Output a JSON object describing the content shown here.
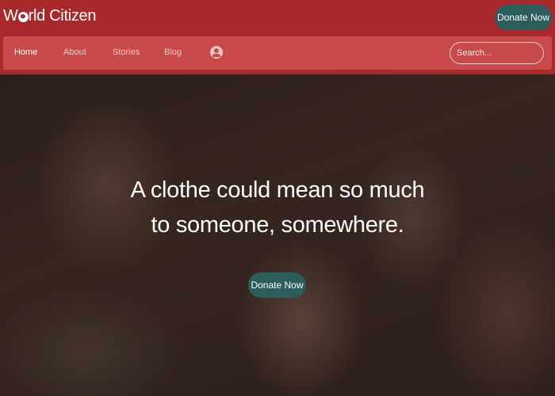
{
  "brand": {
    "name_prefix": "W",
    "name_suffix": "rld Citizen",
    "icon": "globe-icon"
  },
  "header": {
    "donate_label": "Donate Now"
  },
  "nav": {
    "items": [
      {
        "label": "Home",
        "active": true
      },
      {
        "label": "About",
        "active": false
      },
      {
        "label": "Stories",
        "active": false
      },
      {
        "label": "Blog",
        "active": false
      }
    ],
    "user_icon": "user-circle-icon",
    "search_placeholder": "Search..."
  },
  "hero": {
    "line1": "A clothe could mean so much",
    "line2": "to someone, somewhere.",
    "donate_label": "Donate Now",
    "background": "photo of smiling children"
  },
  "colors": {
    "primary": "#a8292b",
    "nav": "#c84a4a",
    "button": "#2a5d5c"
  }
}
